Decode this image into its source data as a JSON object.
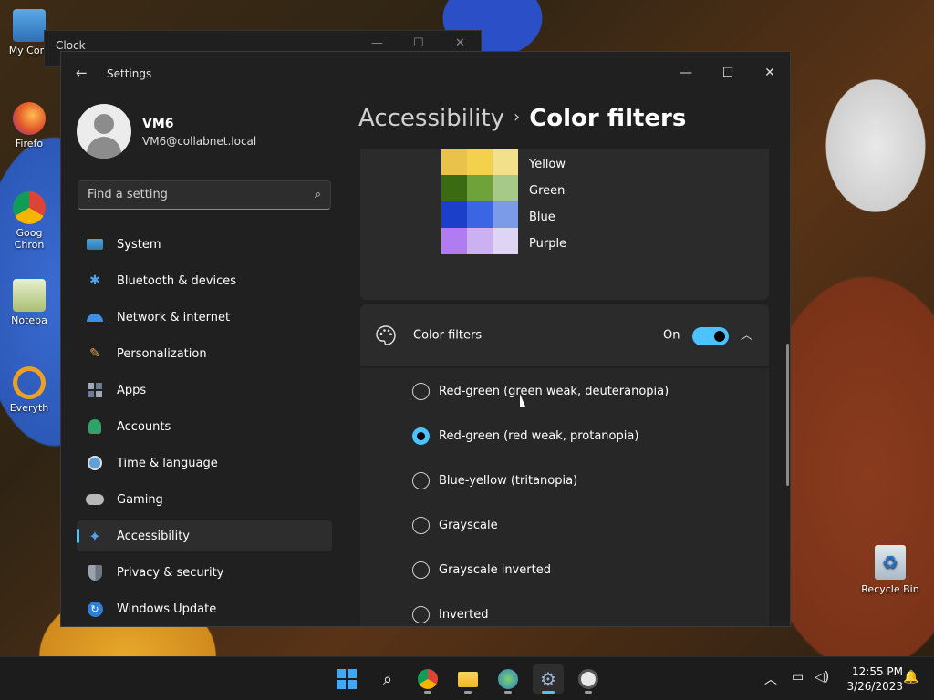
{
  "desktop": {
    "icons": [
      {
        "label": "My Com",
        "icon": "computer-icon"
      },
      {
        "label": "Firefo",
        "icon": "firefox-icon"
      },
      {
        "label": "Goog Chron",
        "icon": "chrome-icon"
      },
      {
        "label": "Notepa",
        "icon": "notepad-icon"
      },
      {
        "label": "Everyth",
        "icon": "everything-search-icon"
      }
    ],
    "recycle_bin": "Recycle Bin"
  },
  "clock_window": {
    "title": "Clock"
  },
  "window": {
    "title": "Settings",
    "controls": {
      "minimize": "—",
      "maximize": "☐",
      "close": "✕"
    }
  },
  "profile": {
    "name": "VM6",
    "email": "VM6@collabnet.local"
  },
  "search": {
    "placeholder": "Find a setting"
  },
  "nav": {
    "items": [
      {
        "label": "System",
        "icon": "system-icon"
      },
      {
        "label": "Bluetooth & devices",
        "icon": "bluetooth-icon"
      },
      {
        "label": "Network & internet",
        "icon": "wifi-icon"
      },
      {
        "label": "Personalization",
        "icon": "brush-icon"
      },
      {
        "label": "Apps",
        "icon": "apps-icon"
      },
      {
        "label": "Accounts",
        "icon": "person-icon"
      },
      {
        "label": "Time & language",
        "icon": "clock-globe-icon"
      },
      {
        "label": "Gaming",
        "icon": "gamepad-icon"
      },
      {
        "label": "Accessibility",
        "icon": "accessibility-icon"
      },
      {
        "label": "Privacy & security",
        "icon": "shield-icon"
      },
      {
        "label": "Windows Update",
        "icon": "update-icon"
      }
    ],
    "active": "Accessibility"
  },
  "breadcrumb": {
    "parent": "Accessibility",
    "separator": "›",
    "current": "Color filters"
  },
  "preview": {
    "rows": [
      {
        "label": "Yellow",
        "colors": [
          "#e8c24a",
          "#f2d24d",
          "#f3e08a"
        ]
      },
      {
        "label": "Green",
        "colors": [
          "#3a6a12",
          "#6fa33a",
          "#a6c98a"
        ]
      },
      {
        "label": "Blue",
        "colors": [
          "#1c3fc9",
          "#3b66e3",
          "#7b9ae8"
        ]
      },
      {
        "label": "Purple",
        "colors": [
          "#b07cf0",
          "#cbb1f2",
          "#e0d4f5"
        ]
      }
    ]
  },
  "color_filters": {
    "title": "Color filters",
    "state_label": "On",
    "enabled": true,
    "options": [
      {
        "label": "Red-green (green weak, deuteranopia)",
        "checked": false
      },
      {
        "label": "Red-green (red weak, protanopia)",
        "checked": true
      },
      {
        "label": "Blue-yellow (tritanopia)",
        "checked": false
      },
      {
        "label": "Grayscale",
        "checked": false
      },
      {
        "label": "Grayscale inverted",
        "checked": false
      },
      {
        "label": "Inverted",
        "checked": false
      }
    ]
  },
  "taskbar": {
    "time": "12:55 PM",
    "date": "3/26/2023",
    "apps": [
      "windows-start-icon",
      "search-icon",
      "chrome-icon",
      "file-explorer-icon",
      "network-app-icon",
      "settings-gear-icon",
      "clock-app-icon"
    ]
  },
  "colors": {
    "accent": "#4cc2ff",
    "window_bg": "#202020",
    "card_bg": "#2b2b2b"
  }
}
